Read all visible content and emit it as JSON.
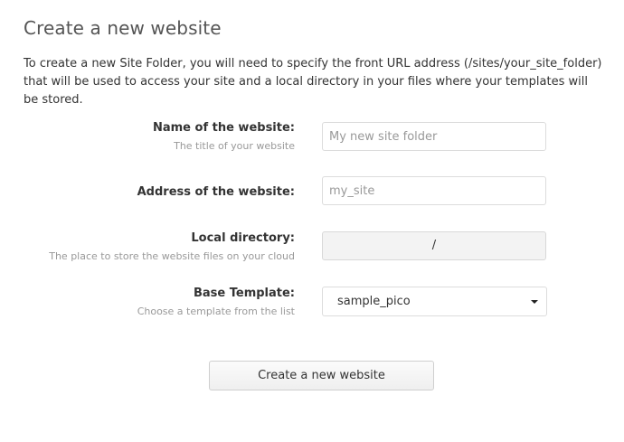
{
  "header": {
    "title": "Create a new website"
  },
  "intro": {
    "text": "To create a new Site Folder, you will need to specify the front URL address (/sites/your_site_folder) that will be used to access your site and a local directory in your files where your templates will be stored."
  },
  "form": {
    "name": {
      "label": "Name of the website:",
      "hint": "The title of your website",
      "value": "",
      "placeholder": "My new site folder"
    },
    "address": {
      "label": "Address of the website:",
      "value": "",
      "placeholder": "my_site"
    },
    "directory": {
      "label": "Local directory:",
      "hint": "The place to store the website files on your cloud",
      "value": "/"
    },
    "template": {
      "label": "Base Template:",
      "hint": "Choose a template from the list",
      "selected": "sample_pico",
      "icon": "caret-down-icon"
    },
    "submit_label": "Create a new website"
  }
}
